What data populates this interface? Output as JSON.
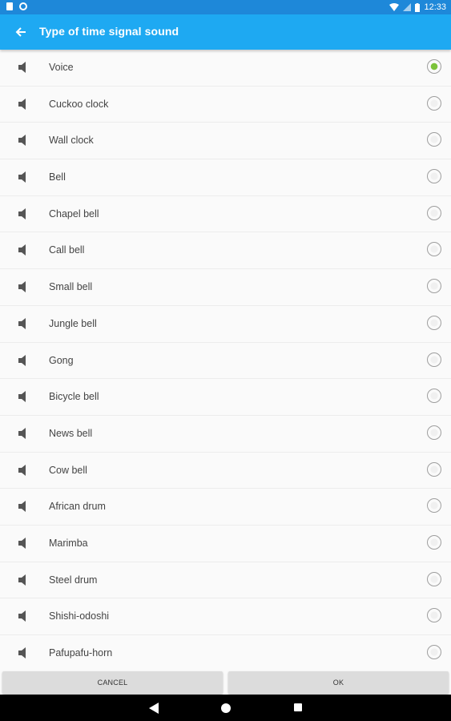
{
  "status_bar": {
    "time": "12:33"
  },
  "app_bar": {
    "title": "Type of time signal sound"
  },
  "sounds": [
    {
      "label": "Voice",
      "selected": true
    },
    {
      "label": "Cuckoo clock",
      "selected": false
    },
    {
      "label": "Wall clock",
      "selected": false
    },
    {
      "label": "Bell",
      "selected": false
    },
    {
      "label": "Chapel bell",
      "selected": false
    },
    {
      "label": "Call bell",
      "selected": false
    },
    {
      "label": "Small bell",
      "selected": false
    },
    {
      "label": "Jungle bell",
      "selected": false
    },
    {
      "label": "Gong",
      "selected": false
    },
    {
      "label": "Bicycle bell",
      "selected": false
    },
    {
      "label": "News bell",
      "selected": false
    },
    {
      "label": "Cow bell",
      "selected": false
    },
    {
      "label": "African drum",
      "selected": false
    },
    {
      "label": "Marimba",
      "selected": false
    },
    {
      "label": "Steel drum",
      "selected": false
    },
    {
      "label": "Shishi-odoshi",
      "selected": false
    },
    {
      "label": "Pafupafu-horn",
      "selected": false
    }
  ],
  "buttons": {
    "cancel_label": "CANCEL",
    "ok_label": "OK"
  },
  "colors": {
    "app_bar": "#1ea9f2",
    "status_bar": "#1e88d9",
    "selected_radio": "#7cc33a"
  }
}
